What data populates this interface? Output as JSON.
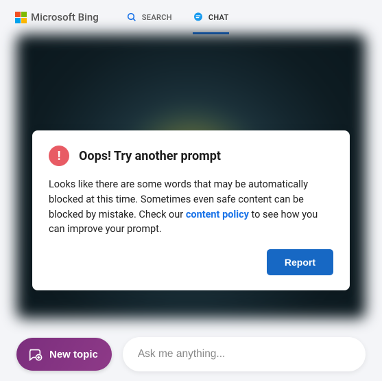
{
  "brand": {
    "text": "Microsoft Bing"
  },
  "nav": {
    "search_label": "SEARCH",
    "chat_label": "CHAT"
  },
  "error": {
    "title": "Oops! Try another prompt",
    "text_before_link": "Looks like there are some words that may be automatically blocked at this time. Sometimes even safe content can be blocked by mistake. Check our ",
    "link_text": "content policy",
    "text_after_link": " to see how you can improve your prompt.",
    "report_label": "Report"
  },
  "bottom": {
    "new_topic_label": "New topic",
    "input_placeholder": "Ask me anything..."
  },
  "colors": {
    "accent": "#1a73e8",
    "error": "#e85b64",
    "new_topic_bg": "#7b2e7d"
  }
}
